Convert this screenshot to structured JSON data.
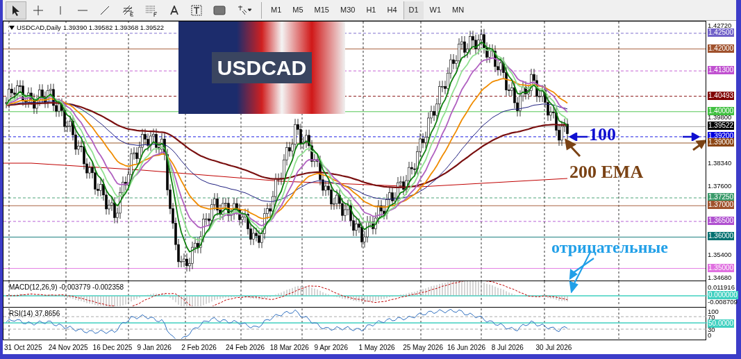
{
  "toolbar": {
    "tools": [
      {
        "kind": "cursor",
        "selected": true
      },
      {
        "kind": "crosshair",
        "selected": false
      },
      {
        "kind": "vline",
        "selected": false
      },
      {
        "kind": "hline",
        "selected": false
      },
      {
        "kind": "trend",
        "selected": false
      },
      {
        "kind": "channel",
        "selected": false
      },
      {
        "kind": "fibo",
        "selected": false
      },
      {
        "kind": "text",
        "selected": false
      },
      {
        "kind": "label",
        "selected": false
      },
      {
        "kind": "rect",
        "selected": false
      },
      {
        "kind": "arrows",
        "selected": false
      }
    ],
    "timeframes": [
      {
        "label": "M1",
        "selected": false
      },
      {
        "label": "M5",
        "selected": false
      },
      {
        "label": "M15",
        "selected": false
      },
      {
        "label": "M30",
        "selected": false
      },
      {
        "label": "H1",
        "selected": false
      },
      {
        "label": "H4",
        "selected": false
      },
      {
        "label": "D1",
        "selected": true
      },
      {
        "label": "W1",
        "selected": false
      },
      {
        "label": "MN",
        "selected": false
      }
    ]
  },
  "chart": {
    "symbol": "USDCAD,Daily",
    "ohlc": "1.39390 1.39582 1.39368 1.39522",
    "banner": "USDCAD",
    "annotations": [
      {
        "kind": "ema100",
        "text": "100",
        "color": "#1010d0"
      },
      {
        "kind": "ema200",
        "text": "200 EMA",
        "color": "#7a4214"
      },
      {
        "kind": "negative",
        "text": "отрицательные",
        "color": "#22a0e8"
      }
    ],
    "price_axis": [
      {
        "text": "1.42720",
        "kind": "tick"
      },
      {
        "text": "1.42500",
        "kind": "level",
        "color": "#7060c8",
        "dashed": true
      },
      {
        "text": "1.42000",
        "kind": "level",
        "color": "#a0522d",
        "dashed": false
      },
      {
        "text": "1.41300",
        "kind": "level",
        "color": "#c050d0",
        "dashed": true
      },
      {
        "text": "1.40493",
        "kind": "level",
        "color": "#800000",
        "dashed": true
      },
      {
        "text": "1.40000",
        "kind": "level",
        "color": "#40c040",
        "dashed": false
      },
      {
        "text": "1.39800",
        "kind": "tick"
      },
      {
        "text": "1.39522",
        "kind": "level",
        "color": "#000000",
        "dashed": false
      },
      {
        "text": "1.39200",
        "kind": "level",
        "color": "#0000e0",
        "dashed": true
      },
      {
        "text": "1.39000",
        "kind": "level",
        "color": "#8b4513",
        "dashed": false
      },
      {
        "text": "1.38340",
        "kind": "tick"
      },
      {
        "text": "1.37600",
        "kind": "tick"
      },
      {
        "text": "1.37250",
        "kind": "level",
        "color": "#3a9a6a",
        "dashed": true
      },
      {
        "text": "1.37000",
        "kind": "level",
        "color": "#a0522d",
        "dashed": false
      },
      {
        "text": "1.36500",
        "kind": "level",
        "color": "#b050d0",
        "dashed": true
      },
      {
        "text": "1.36000",
        "kind": "level",
        "color": "#007070",
        "dashed": false
      },
      {
        "text": "1.35400",
        "kind": "tick"
      },
      {
        "text": "1.35000",
        "kind": "level",
        "color": "#e070e0",
        "dashed": false
      },
      {
        "text": "1.34680",
        "kind": "tick"
      }
    ]
  },
  "macd": {
    "label": "MACD(12,26,9) -0.003779 -0.002358",
    "axis": [
      {
        "text": "0.011916",
        "kind": "tick"
      },
      {
        "text": "0.000000",
        "kind": "level",
        "color": "#40d0c0"
      },
      {
        "text": "-0.008709",
        "kind": "tick"
      }
    ]
  },
  "rsi": {
    "label": "RSI(14) 37.8656",
    "axis": [
      {
        "text": "100",
        "kind": "tick"
      },
      {
        "text": "70",
        "kind": "tick"
      },
      {
        "text": "50.0000",
        "kind": "level",
        "color": "#40d0c0"
      },
      {
        "text": "30",
        "kind": "tick"
      },
      {
        "text": "0",
        "kind": "tick"
      }
    ]
  },
  "dates": [
    "31 Oct 2025",
    "24 Nov 2025",
    "16 Dec 2025",
    "9 Jan 2026",
    "2 Feb 2026",
    "24 Feb 2026",
    "18 Mar 2026",
    "9 Apr 2026",
    "1 May 2026",
    "25 May 2026",
    "16 Jun 2026",
    "8 Jul 2026",
    "30 Jul 2026"
  ]
}
